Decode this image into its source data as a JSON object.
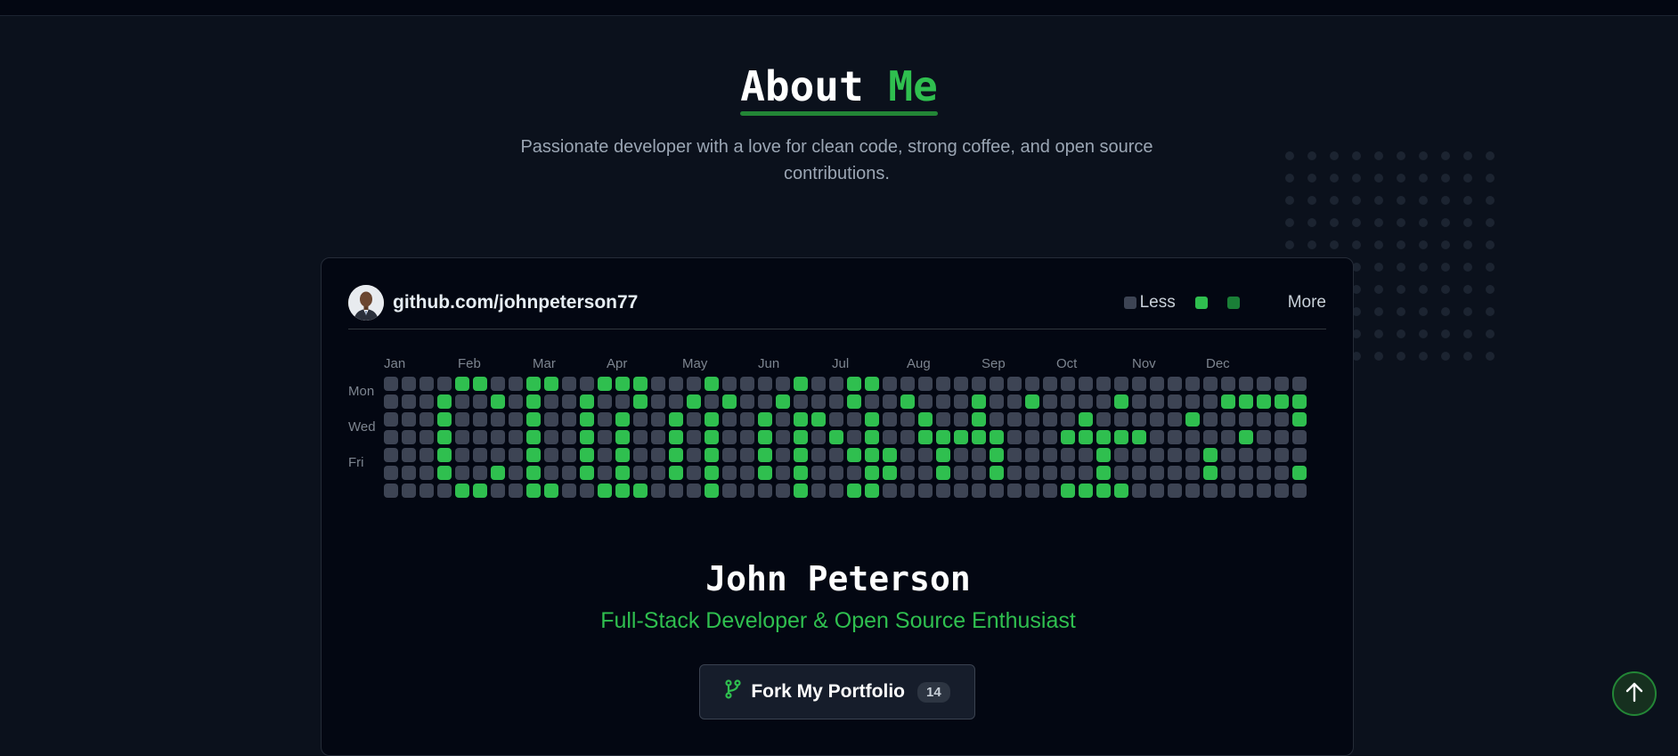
{
  "header": {
    "title_main": "About",
    "title_accent": "Me",
    "subtitle": "Passionate developer with a love for clean code, strong coffee, and open source contributions."
  },
  "profile": {
    "repo_link": "github.com/johnpeterson77",
    "name": "John Peterson",
    "role": "Full-Stack Developer & Open Source Enthusiast"
  },
  "legend": {
    "less": "Less",
    "more": "More",
    "colors": [
      "#3d4454",
      "#2fbf4f",
      "#1a7f37"
    ]
  },
  "contribution_graph": {
    "months": [
      "Jan",
      "Feb",
      "Mar",
      "Apr",
      "May",
      "Jun",
      "Jul",
      "Aug",
      "Sep",
      "Oct",
      "Nov",
      "Dec"
    ],
    "day_labels": [
      "Mon",
      "Wed",
      "Fri"
    ],
    "colors": {
      "empty": "#3d4454",
      "active": "#2fbf4f"
    },
    "rows": [
      "....##..##..###...#....#..##.........................",
      "...#..#.#..#..#..#.#..#...#..#...#..#....#.....######",
      "...#....#..#.#..#.#..#.##..#..#..#.....#.....#.....##",
      "...#....#..#.#..#.#..#.#.#.#..#####...#####.....#.....#",
      "...#....#..#.#..#.#..#.#..###..#..#.....#.....#.....#",
      "...#..#.#..#.#..#.#..#.#...##..#..#.....#.....#....##",
      "....##..##..###...#....#..##..........####..."
    ]
  },
  "fork_button": {
    "label": "Fork My Portfolio",
    "count": "14"
  },
  "colors": {
    "accent": "#2fbf4f",
    "background": "#0b111c",
    "card": "#030712"
  }
}
